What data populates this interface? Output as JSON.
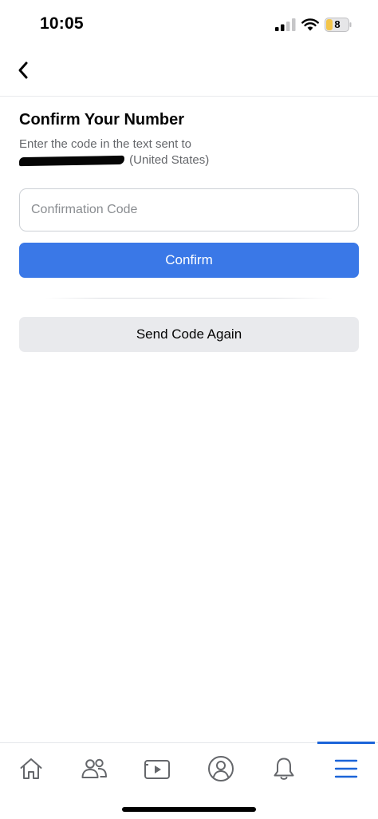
{
  "status_bar": {
    "time": "10:05",
    "battery_level": "8"
  },
  "nav": {
    "back_icon": "chevron-left-icon"
  },
  "main": {
    "title": "Confirm Your Number",
    "instruction": "Enter the code in the text sent to",
    "phone_country": "(United States)",
    "code_input": {
      "placeholder": "Confirmation Code",
      "value": ""
    },
    "confirm_label": "Confirm",
    "resend_label": "Send Code Again"
  },
  "tab_bar": {
    "tabs": [
      {
        "id": "home",
        "icon": "home-icon"
      },
      {
        "id": "friends",
        "icon": "friends-icon"
      },
      {
        "id": "watch",
        "icon": "video-icon"
      },
      {
        "id": "profile",
        "icon": "profile-icon"
      },
      {
        "id": "notifications",
        "icon": "bell-icon"
      },
      {
        "id": "menu",
        "icon": "menu-icon",
        "active": true
      }
    ]
  },
  "colors": {
    "primary": "#3a78e7",
    "secondary_button": "#e9eaed",
    "text": "#050505",
    "muted_text": "#65676b",
    "active_tab": "#1b64d8",
    "icon": "#65676b",
    "battery_fill": "#f3c54a"
  }
}
